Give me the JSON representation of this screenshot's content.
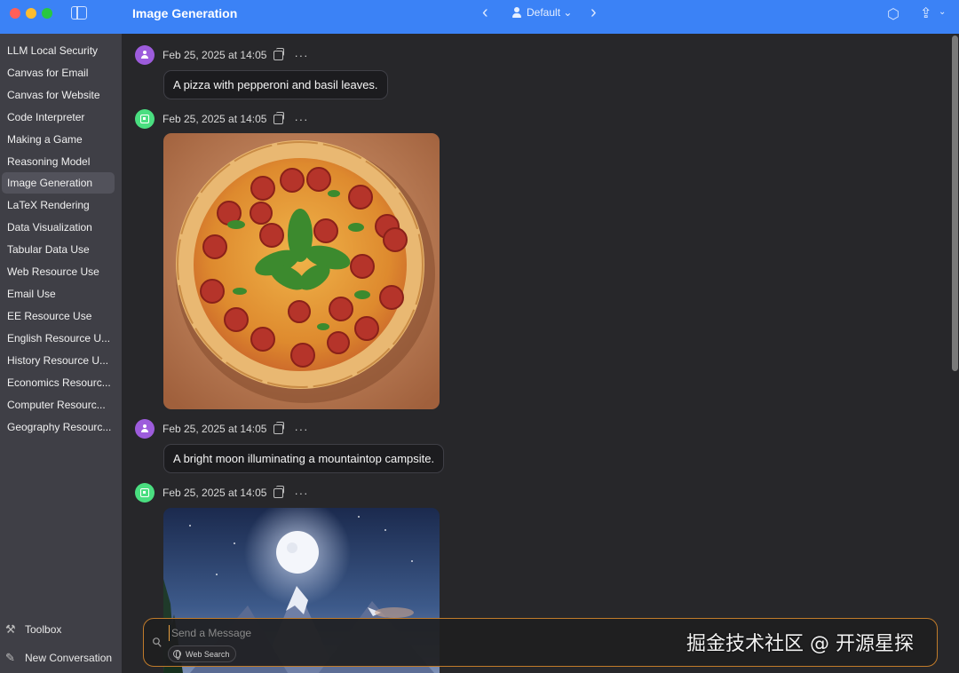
{
  "window": {
    "title": "Image Generation"
  },
  "toolbar": {
    "profile_label": "Default ⌄"
  },
  "sidebar": {
    "items": [
      {
        "label": "LLM Local Security"
      },
      {
        "label": "Canvas for Email"
      },
      {
        "label": "Canvas for Website"
      },
      {
        "label": "Code Interpreter"
      },
      {
        "label": "Making a Game"
      },
      {
        "label": "Reasoning Model"
      },
      {
        "label": "Image Generation",
        "active": true
      },
      {
        "label": "LaTeX Rendering"
      },
      {
        "label": "Data Visualization"
      },
      {
        "label": "Tabular Data Use"
      },
      {
        "label": "Web Resource Use"
      },
      {
        "label": "Email Use"
      },
      {
        "label": "EE Resource Use"
      },
      {
        "label": "English Resource U..."
      },
      {
        "label": "History Resource U..."
      },
      {
        "label": "Economics Resourc..."
      },
      {
        "label": "Computer Resourc..."
      },
      {
        "label": "Geography Resourc..."
      }
    ],
    "toolbox_label": "Toolbox",
    "new_conversation_label": "New Conversation"
  },
  "messages": [
    {
      "role": "user",
      "timestamp": "Feb 25, 2025 at 14:05",
      "text": "A pizza with pepperoni and basil leaves."
    },
    {
      "role": "assistant",
      "timestamp": "Feb 25, 2025 at 14:05",
      "image": "pizza with pepperoni and basil"
    },
    {
      "role": "user",
      "timestamp": "Feb 25, 2025 at 14:05",
      "text": "A bright moon illuminating a mountaintop campsite."
    },
    {
      "role": "assistant",
      "timestamp": "Feb 25, 2025 at 14:05",
      "image": "moon over mountain campsite"
    }
  ],
  "composer": {
    "placeholder": "Send a Message",
    "web_search_label": "Web Search"
  },
  "watermark": "掘金技术社区 @ 开源星探",
  "icons": [
    "sidebar-toggle-icon",
    "chevron-left-icon",
    "chevron-right-icon",
    "user-icon",
    "cube-icon",
    "share-icon",
    "copy-icon",
    "more-icon",
    "wrench-icon",
    "compose-icon",
    "paperclip-icon",
    "globe-icon"
  ],
  "colors": {
    "titlebar": "#3b82f6",
    "user_avatar": "#9d5cdc",
    "bot_avatar": "#4ade80",
    "composer_border": "#c07b2a"
  }
}
